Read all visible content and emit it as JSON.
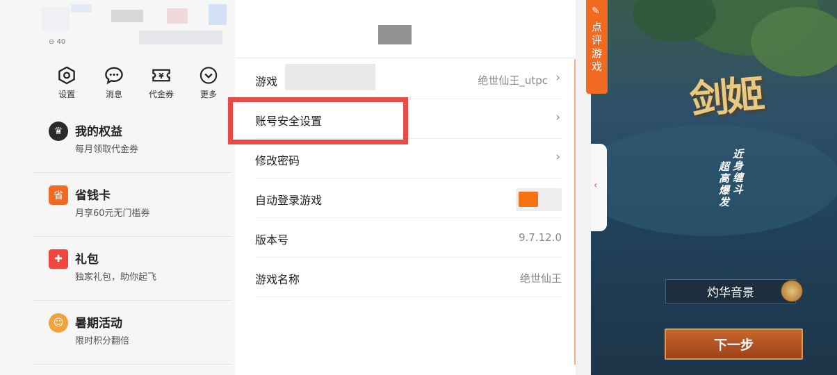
{
  "left_panel": {
    "user_id_prefix": "40",
    "quick_actions": [
      {
        "label": "设置",
        "icon": "settings-hex-icon"
      },
      {
        "label": "消息",
        "icon": "message-bubble-icon"
      },
      {
        "label": "代金券",
        "icon": "voucher-icon"
      },
      {
        "label": "更多",
        "icon": "more-chevron-icon"
      }
    ],
    "menu": [
      {
        "title": "我的权益",
        "subtitle": "每月领取代金券",
        "icon": "crown-icon",
        "color": "#2a2a2a"
      },
      {
        "title": "省钱卡",
        "subtitle": "月享60元无门槛券",
        "icon": "card-icon",
        "color": "#f06a22"
      },
      {
        "title": "礼包",
        "subtitle": "独家礼包，助你起飞",
        "icon": "gift-icon",
        "color": "#f2453d"
      },
      {
        "title": "暑期活动",
        "subtitle": "限时积分翻倍",
        "icon": "event-icon",
        "color": "#f0a23c"
      }
    ]
  },
  "settings": {
    "rows": [
      {
        "label": "游戏",
        "value": "绝世仙王_utpc",
        "has_chevron": true
      },
      {
        "label": "账号安全设置",
        "value": "",
        "has_chevron": true
      },
      {
        "label": "修改密码",
        "value": "",
        "has_chevron": true
      },
      {
        "label": "自动登录游戏",
        "toggle": true
      },
      {
        "label": "版本号",
        "value": "9.7.12.0"
      },
      {
        "label": "游戏名称",
        "value": "绝世仙王"
      }
    ],
    "accent": "#f57314",
    "highlight_color": "#e84a47"
  },
  "game_panel": {
    "review_tab": "点评游戏",
    "collapse_glyph": "‹",
    "logo": "剑姬",
    "tagline_1": "近身缠斗",
    "tagline_2": "超高爆发",
    "sound_label": "灼华音景",
    "next_label": "下一步"
  }
}
